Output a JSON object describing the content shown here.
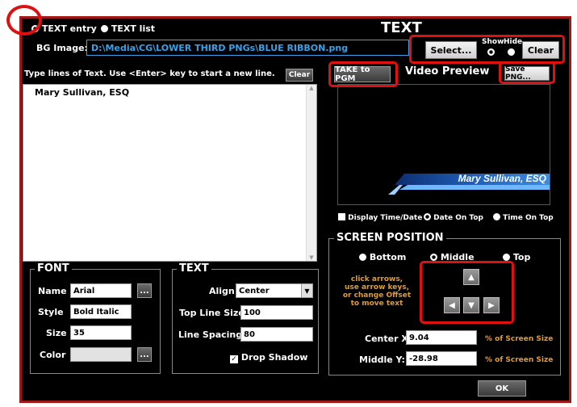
{
  "mode": {
    "entry_label": "TEXT entry",
    "list_label": "TEXT list"
  },
  "title": "TEXT",
  "bg_image": {
    "label": "BG Image:",
    "path": "D:\\Media\\CG\\LOWER THIRD PNGs\\BLUE RIBBON.png",
    "select_label": "Select...",
    "show_label": "Show",
    "hide_label": "Hide",
    "clear_label": "Clear"
  },
  "text_area": {
    "instruction": "Type lines of Text.  Use <Enter> key to start a new line.",
    "clear_label": "Clear",
    "content": "Mary Sullivan, ESQ"
  },
  "preview": {
    "take_label": "TAKE to PGM",
    "title": "Video Preview",
    "save_label": "Save PNG...",
    "overlay_text": "Mary Sullivan, ESQ"
  },
  "display_opts": {
    "time_date_label": "Display Time/Date",
    "date_top_label": "Date On Top",
    "time_top_label": "Time On Top"
  },
  "font": {
    "title": "FONT",
    "name_label": "Name",
    "name_value": "Arial",
    "style_label": "Style",
    "style_value": "Bold Italic",
    "size_label": "Size",
    "size_value": "35",
    "color_label": "Color",
    "ellipsis": "..."
  },
  "text_opts": {
    "title": "TEXT",
    "align_label": "Align",
    "align_value": "Center",
    "top_line_label": "Top Line Size",
    "top_line_value": "100",
    "spacing_label": "Line Spacing",
    "spacing_value": "80",
    "shadow_label": "Drop Shadow"
  },
  "position": {
    "title": "SCREEN POSITION",
    "bottom_label": "Bottom",
    "middle_label": "Middle",
    "top_label": "Top",
    "hint_lines": [
      "click arrows,",
      "use arrow keys,",
      "or change Offset",
      "to move text"
    ],
    "center_x_label": "Center X:",
    "center_x_value": "9.04",
    "middle_y_label": "Middle Y:",
    "middle_y_value": "-28.98",
    "unit_label": "% of Screen Size"
  },
  "ok_label": "OK",
  "colors": {
    "highlight": "#e01010",
    "border": "#a01818",
    "path_text": "#3aa0e8",
    "hint": "#e59a2c"
  }
}
